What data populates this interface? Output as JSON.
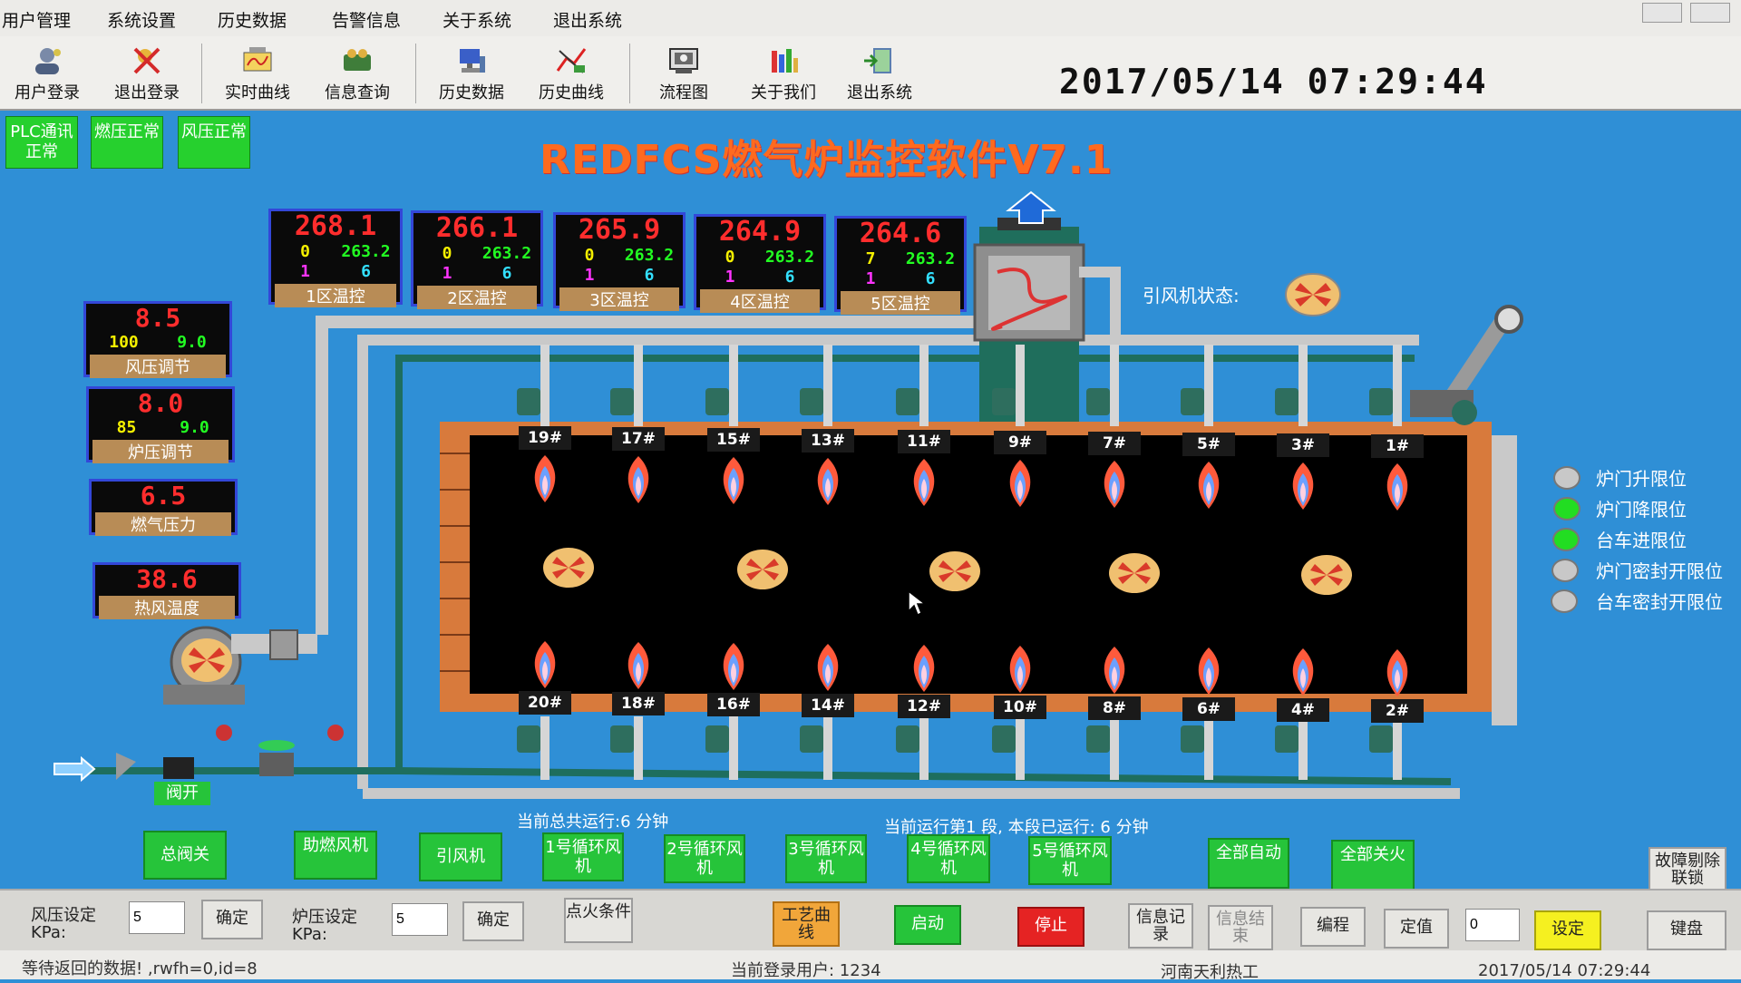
{
  "menu": [
    "用户管理",
    "系统设置",
    "历史数据",
    "告警信息",
    "关于系统",
    "退出系统"
  ],
  "toolbar": {
    "items": [
      {
        "label": "用户登录",
        "icon": "user-login-icon"
      },
      {
        "label": "退出登录",
        "icon": "logout-icon"
      },
      {
        "label": "实时曲线",
        "icon": "realtime-curve-icon"
      },
      {
        "label": "信息查询",
        "icon": "info-query-icon"
      },
      {
        "label": "历史数据",
        "icon": "history-data-icon"
      },
      {
        "label": "历史曲线",
        "icon": "history-curve-icon"
      },
      {
        "label": "流程图",
        "icon": "flowchart-icon"
      },
      {
        "label": "关于我们",
        "icon": "about-icon"
      },
      {
        "label": "退出系统",
        "icon": "exit-icon"
      }
    ],
    "datetime": "2017/05/14  07:29:44"
  },
  "status_buttons": [
    "PLC通讯正常",
    "燃压正常",
    "风压正常"
  ],
  "title": "REDFCS燃气炉监控软件V7.1",
  "zones": [
    {
      "pv": "268.1",
      "a": "0",
      "sv": "263.2",
      "b": "1",
      "c": "6",
      "label": "1区温控"
    },
    {
      "pv": "266.1",
      "a": "0",
      "sv": "263.2",
      "b": "1",
      "c": "6",
      "label": "2区温控"
    },
    {
      "pv": "265.9",
      "a": "0",
      "sv": "263.2",
      "b": "1",
      "c": "6",
      "label": "3区温控"
    },
    {
      "pv": "264.9",
      "a": "0",
      "sv": "263.2",
      "b": "1",
      "c": "6",
      "label": "4区温控"
    },
    {
      "pv": "264.6",
      "a": "7",
      "sv": "263.2",
      "b": "1",
      "c": "6",
      "label": "5区温控"
    }
  ],
  "left_panels": [
    {
      "value": "8.5",
      "a": "100",
      "b": "9.0",
      "label": "风压调节"
    },
    {
      "value": "8.0",
      "a": "85",
      "b": "9.0",
      "label": "炉压调节"
    },
    {
      "value": "6.5",
      "label": "燃气压力"
    },
    {
      "value": "38.6",
      "label": "热风温度"
    }
  ],
  "fan_status_label": "引风机状态:",
  "burners_top": [
    "19#",
    "17#",
    "15#",
    "13#",
    "11#",
    "9#",
    "7#",
    "5#",
    "3#",
    "1#"
  ],
  "burners_bottom": [
    "20#",
    "18#",
    "16#",
    "14#",
    "12#",
    "10#",
    "8#",
    "6#",
    "4#",
    "2#"
  ],
  "valve_open_label": "阀开",
  "limit_lamps": [
    {
      "label": "炉门升限位",
      "color": "#c8c8c8"
    },
    {
      "label": "炉门降限位",
      "color": "#22dd22"
    },
    {
      "label": "台车进限位",
      "color": "#22dd22"
    },
    {
      "label": "炉门密封开限位",
      "color": "#c8c8c8"
    },
    {
      "label": "台车密封开限位",
      "color": "#c8c8c8"
    }
  ],
  "run_total": "当前总共运行:6 分钟",
  "run_stage": "当前运行第1 段, 本段已运行: 6 分钟",
  "controls": [
    "总阀关",
    "助燃风机",
    "引风机",
    "1号循环风机",
    "2号循环风机",
    "3号循环风机",
    "4号循环风机",
    "5号循环风机",
    "全部自动",
    "全部关火"
  ],
  "fault_reset": "故障剔除联锁",
  "bottom": {
    "wind_label": "风压设定 KPa:",
    "wind_value": "5",
    "wind_confirm": "确定",
    "furnace_label": "炉压设定 KPa:",
    "furnace_value": "5",
    "furnace_confirm": "确定",
    "ignite": "点火条件",
    "process_curve": "工艺曲线",
    "start": "启动",
    "stop": "停止",
    "info_record": "信息记录",
    "info_end": "信息结束",
    "program": "编程",
    "fixed": "定值",
    "set_value": "0",
    "set": "设定",
    "keyboard": "键盘"
  },
  "statusbar": {
    "left": "等待返回的数据!  ,rwfh=0,id=8",
    "user": "当前登录用户:  1234",
    "company": "河南天利热工",
    "right": "2017/05/14  07:29:44"
  }
}
